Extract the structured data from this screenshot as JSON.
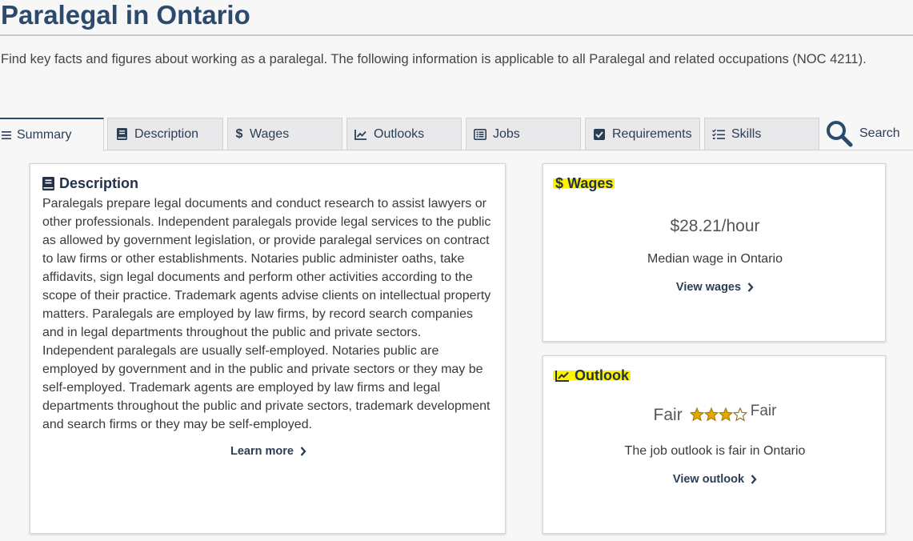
{
  "page": {
    "title": "Paralegal in Ontario",
    "intro": "Find key facts and figures about working as a paralegal. The following information is applicable to all Paralegal and related occupations (NOC 4211)."
  },
  "tabs": [
    {
      "label": "Summary",
      "icon": "menu-icon",
      "active": true
    },
    {
      "label": "Description",
      "icon": "book-icon"
    },
    {
      "label": "Wages",
      "icon": "dollar-icon"
    },
    {
      "label": "Outlooks",
      "icon": "trend-chart-icon"
    },
    {
      "label": "Jobs",
      "icon": "list-icon"
    },
    {
      "label": "Requirements",
      "icon": "checkbox-icon"
    },
    {
      "label": "Skills",
      "icon": "checklist-icon"
    }
  ],
  "search": {
    "label": "Search",
    "icon": "search-icon"
  },
  "description_card": {
    "heading": "Description",
    "text": "Paralegals prepare legal documents and conduct research to assist lawyers or other professionals. Independent paralegals provide legal services to the public as allowed by government legislation, or provide paralegal services on contract to law firms or other establishments. Notaries public administer oaths, take affidavits, sign legal documents and perform other activities according to the scope of their practice. Trademark agents advise clients on intellectual property matters. Paralegals are employed by law firms, by record search companies and in legal departments throughout the public and private sectors. Independent paralegals are usually self-employed. Notaries public are employed by government and in the public and private sectors or they may be self-employed. Trademark agents are employed by law firms and legal departments throughout the public and private sectors, trademark development and search firms or they may be self-employed.",
    "link": "Learn more"
  },
  "wages_card": {
    "heading": "Wages",
    "heading_symbol": "$",
    "value": "$28.21/hour",
    "caption": "Median wage in Ontario",
    "link": "View wages"
  },
  "outlook_card": {
    "heading": "Outlook",
    "rating_text": "Fair",
    "stars_text": "Fair",
    "stars_filled": 3,
    "stars_total": 5,
    "caption": "The job outlook is fair in Ontario",
    "link": "View outlook"
  },
  "colors": {
    "title": "#2c4a6e",
    "highlight": "#fff200",
    "star": "#e0a800"
  }
}
